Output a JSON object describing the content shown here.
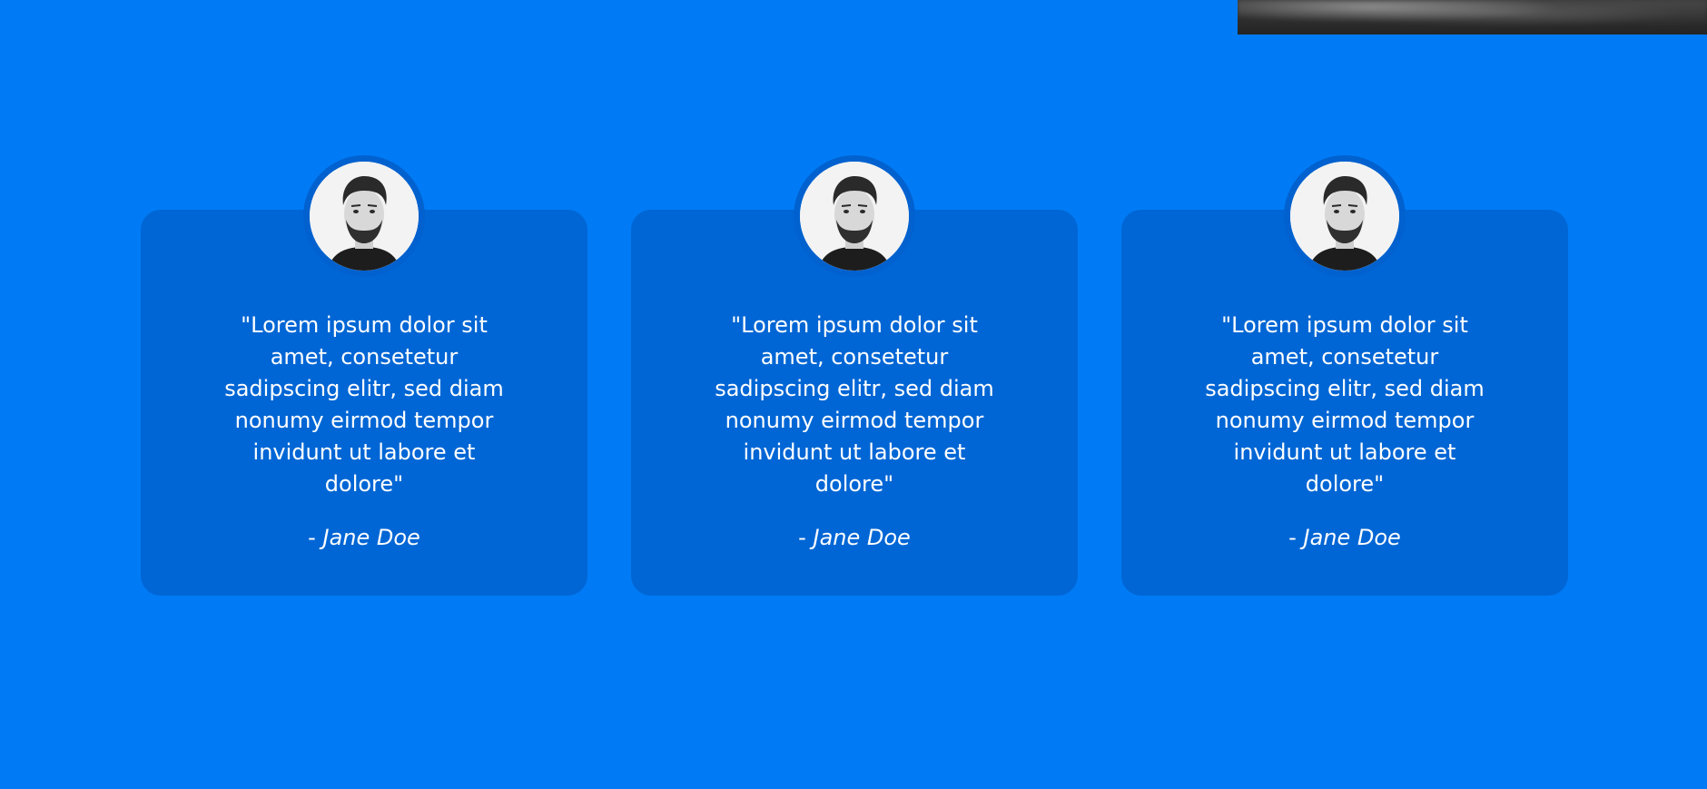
{
  "colors": {
    "background": "#007bf5",
    "card": "#0066d5",
    "text": "#ffffff"
  },
  "header_image": {
    "icon": "photo-strip"
  },
  "testimonials": [
    {
      "avatar_icon": "person-avatar-icon",
      "quote": "\"Lorem ipsum dolor sit amet, consetetur sadipscing elitr, sed diam nonumy eirmod tempor invidunt ut labore et dolore\"",
      "author_dash": "-",
      "author": "Jane Doe"
    },
    {
      "avatar_icon": "person-avatar-icon",
      "quote": "\"Lorem ipsum dolor sit amet, consetetur sadipscing elitr, sed diam nonumy eirmod tempor invidunt ut labore et dolore\"",
      "author_dash": "-",
      "author": "Jane Doe"
    },
    {
      "avatar_icon": "person-avatar-icon",
      "quote": "\"Lorem ipsum dolor sit amet, consetetur sadipscing elitr, sed diam nonumy eirmod tempor invidunt ut labore et dolore\"",
      "author_dash": "-",
      "author": "Jane Doe"
    }
  ]
}
